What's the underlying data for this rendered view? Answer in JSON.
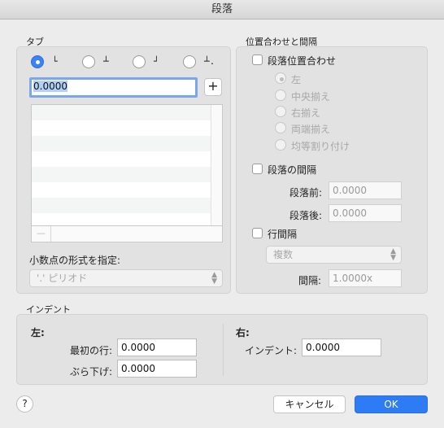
{
  "window": {
    "title": "段落"
  },
  "tabs_group": {
    "label": "タブ",
    "tab_types": [
      {
        "glyph": "└",
        "selected": true
      },
      {
        "glyph": "┴",
        "selected": false
      },
      {
        "glyph": "┘",
        "selected": false
      },
      {
        "glyph": "┴.",
        "selected": false
      }
    ],
    "position_value": "0.0000",
    "add_label": "+",
    "remove_label": "—",
    "decimal_label": "小数点の形式を指定:",
    "decimal_select": "'.' ピリオド"
  },
  "spacing_group": {
    "label": "位置合わせと間隔",
    "alignment_check": "段落位置合わせ",
    "alignment_options": [
      "左",
      "中央揃え",
      "右揃え",
      "両端揃え",
      "均等割り付け"
    ],
    "paragraph_spacing_check": "段落の間隔",
    "before_label": "段落前:",
    "before_value": "0.0000",
    "after_label": "段落後:",
    "after_value": "0.0000",
    "line_spacing_check": "行間隔",
    "line_spacing_select": "複数",
    "spacing_label": "間隔:",
    "spacing_value": "1.0000x"
  },
  "indent_group": {
    "label": "インデント",
    "left_title": "左:",
    "first_line_label": "最初の行:",
    "first_line_value": "0.0000",
    "hanging_label": "ぶら下げ:",
    "hanging_value": "0.0000",
    "right_title": "右:",
    "right_indent_label": "インデント:",
    "right_indent_value": "0.0000"
  },
  "footer": {
    "help_label": "?",
    "cancel_label": "キャンセル",
    "ok_label": "OK"
  }
}
